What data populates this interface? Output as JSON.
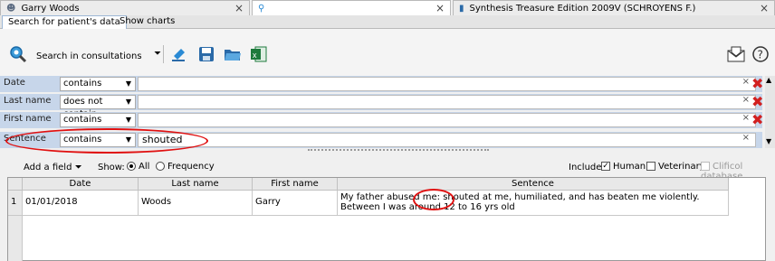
{
  "window_tabs": [
    {
      "title": "Garry Woods"
    },
    {
      "title": ""
    },
    {
      "title": "Synthesis Treasure Edition 2009V (SCHROYENS F.)"
    }
  ],
  "subtabs": [
    "Search for patient's data",
    "Show charts"
  ],
  "toolbar": {
    "search_label": "Search in consultations"
  },
  "filters": [
    {
      "field": "Date",
      "operator": "contains",
      "value": ""
    },
    {
      "field": "Last name",
      "operator": "does not contain",
      "value": ""
    },
    {
      "field": "First name",
      "operator": "contains",
      "value": ""
    },
    {
      "field": "Sentence",
      "operator": "contains",
      "value": "shouted"
    }
  ],
  "options": {
    "add_field": "Add a field",
    "show_label": "Show:",
    "show_all": "All",
    "show_frequency": "Frequency",
    "include_label": "Include:",
    "include_human": "Human",
    "include_veterinary": "Veterinary",
    "include_clificol": "Clificol database"
  },
  "table": {
    "columns": [
      "Date",
      "Last name",
      "First name",
      "Sentence"
    ],
    "rows": [
      {
        "num": "1",
        "date": "01/01/2018",
        "last_name": "Woods",
        "first_name": "Garry",
        "sentence": "My father abused me: shouted at me, humiliated, and has beaten me violently. Between I was around 12 to 16 yrs old"
      }
    ]
  },
  "colors": {
    "accent_red": "#e01010",
    "filter_row_bg": "#c7d6ea"
  }
}
